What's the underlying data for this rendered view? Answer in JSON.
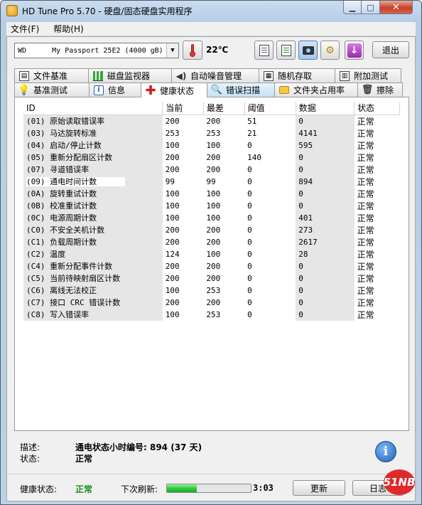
{
  "window": {
    "title": "HD Tune Pro 5.70 - 硬盘/固态硬盘实用程序"
  },
  "menu": {
    "items": [
      "文件(F)",
      "帮助(H)"
    ]
  },
  "toolbar": {
    "drive": "WD      My Passport 25E2 (4000 gB)",
    "temperature": "22℃",
    "exit_label": "退出",
    "icons": [
      "copy-text-icon",
      "copy-screenshot-icon",
      "camera-icon",
      "options-icon",
      "save-icon"
    ]
  },
  "tabs": {
    "row1": [
      "文件基准",
      "磁盘监视器",
      "自动噪音管理",
      "随机存取",
      "附加测试"
    ],
    "row2": [
      "基准测试",
      "信息",
      "健康状态",
      "错误扫描",
      "文件夹占用率",
      "擦除"
    ],
    "active": "健康状态"
  },
  "table": {
    "headers": [
      "ID",
      "当前",
      "最差",
      "阈值",
      "数据",
      "状态"
    ],
    "rows": [
      [
        "(01) 原始读取错误率",
        "200",
        "200",
        "51",
        "0",
        "正常"
      ],
      [
        "(03) 马达旋转标准",
        "253",
        "253",
        "21",
        "4141",
        "正常"
      ],
      [
        "(04) 启动/停止计数",
        "100",
        "100",
        "0",
        "595",
        "正常"
      ],
      [
        "(05) 重新分配扇区计数",
        "200",
        "200",
        "140",
        "0",
        "正常"
      ],
      [
        "(07) 寻道错误率",
        "200",
        "200",
        "0",
        "0",
        "正常"
      ],
      [
        "(09) 通电时间计数",
        "99",
        "99",
        "0",
        "894",
        "正常"
      ],
      [
        "(0A) 旋转重试计数",
        "100",
        "100",
        "0",
        "0",
        "正常"
      ],
      [
        "(0B) 校准重试计数",
        "100",
        "100",
        "0",
        "0",
        "正常"
      ],
      [
        "(0C) 电源周期计数",
        "100",
        "100",
        "0",
        "401",
        "正常"
      ],
      [
        "(C0) 不安全关机计数",
        "200",
        "200",
        "0",
        "273",
        "正常"
      ],
      [
        "(C1) 负载周期计数",
        "200",
        "200",
        "0",
        "2617",
        "正常"
      ],
      [
        "(C2) 温度",
        "124",
        "100",
        "0",
        "28",
        "正常"
      ],
      [
        "(C4) 重新分配事件计数",
        "200",
        "200",
        "0",
        "0",
        "正常"
      ],
      [
        "(C5) 当前待映射扇区计数",
        "200",
        "200",
        "0",
        "0",
        "正常"
      ],
      [
        "(C6) 离线无法校正",
        "100",
        "253",
        "0",
        "0",
        "正常"
      ],
      [
        "(C7) 接口 CRC 错误计数",
        "200",
        "200",
        "0",
        "0",
        "正常"
      ],
      [
        "(C8) 写入错误率",
        "100",
        "253",
        "0",
        "0",
        "正常"
      ]
    ],
    "selected_index": 5
  },
  "description": {
    "desc_label": "描述:",
    "desc_value": "通电状态小时编号: 894 (37 天)",
    "status_label": "状态:",
    "status_value": "正常"
  },
  "status_bar": {
    "health_label": "健康状态:",
    "health_value": "正常",
    "refresh_label": "下次刷新:",
    "refresh_progress": 0.36,
    "countdown": "3:03",
    "refresh_button": "更新",
    "log_button": "日志"
  },
  "watermark": "51NB",
  "colors": {
    "health_ok": "#1a8a1a",
    "accent_red": "#e0292a"
  }
}
